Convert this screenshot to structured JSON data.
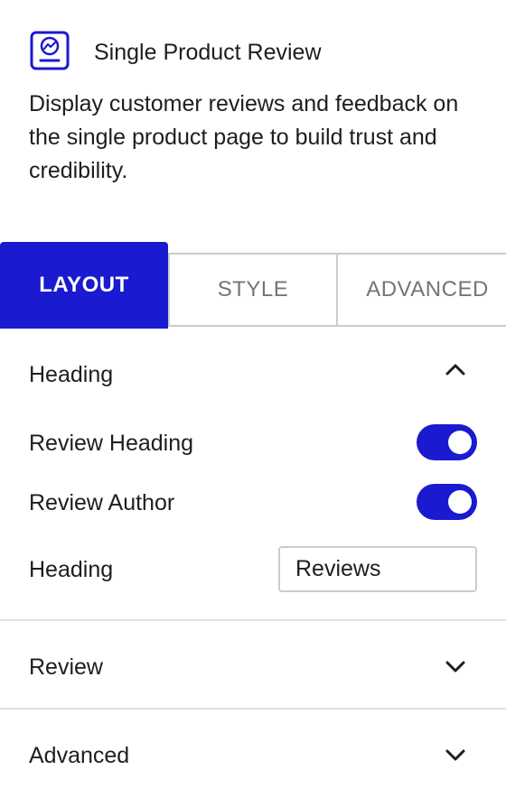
{
  "block": {
    "title": "Single Product Review",
    "description": "Display customer reviews and feedback on the single product page to build trust and credibility.",
    "icon": "product-review-icon",
    "accent_color": "#1a1ad0"
  },
  "tabs": [
    {
      "label": "LAYOUT",
      "active": true
    },
    {
      "label": "STYLE",
      "active": false
    },
    {
      "label": "ADVANCED",
      "active": false
    }
  ],
  "panels": {
    "heading": {
      "title": "Heading",
      "expanded": true,
      "review_heading_label": "Review Heading",
      "review_heading_enabled": true,
      "review_author_label": "Review Author",
      "review_author_enabled": true,
      "heading_field_label": "Heading",
      "heading_field_value": "Reviews"
    },
    "review": {
      "title": "Review",
      "expanded": false
    },
    "advanced": {
      "title": "Advanced",
      "expanded": false
    }
  }
}
